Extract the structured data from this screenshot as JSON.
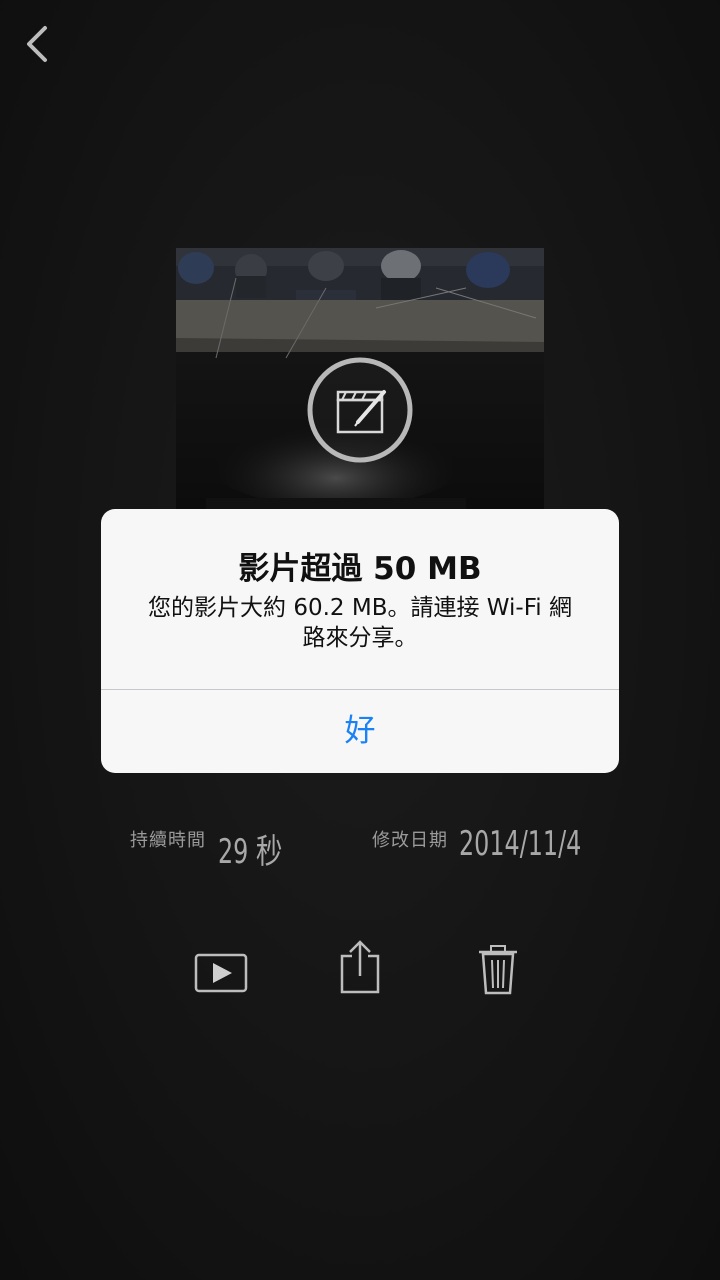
{
  "nav": {
    "back_icon": "chevron-left-icon"
  },
  "video": {
    "edit_icon": "clapperboard-edit-icon"
  },
  "alert": {
    "title": "影片超過 50 MB",
    "message_line1": "您的影片大約 60.2 MB。請連接 Wi-Fi 網",
    "message_line2": "路來分享。",
    "ok_label": "好"
  },
  "info": {
    "duration_label": "持續時間",
    "duration_value": "29 秒",
    "modified_label": "修改日期",
    "modified_value": "2014/11/4"
  },
  "actions": {
    "play_icon": "play-icon",
    "share_icon": "share-icon",
    "delete_icon": "trash-icon"
  },
  "colors": {
    "background": "#151515",
    "alert_bg": "#f7f7f7",
    "accent": "#1a82f5",
    "icon": "#bdbdbd"
  }
}
